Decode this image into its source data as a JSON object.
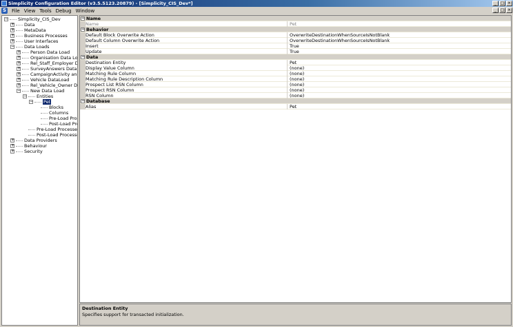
{
  "window": {
    "title": "Simplicity Configuration Editor (v3.5.5123.20879) - [Simplicity_CIS_Dev*]",
    "controls": [
      "_",
      "□",
      "×"
    ]
  },
  "menu": {
    "app_icon_letter": "S",
    "items": [
      "File",
      "View",
      "Tools",
      "Debug",
      "Window"
    ],
    "mdi_controls": [
      "_",
      "□",
      "×"
    ]
  },
  "tree": {
    "nodes": [
      {
        "label": "Simplicity_CIS_Dev",
        "depth": 0,
        "expander": "−"
      },
      {
        "label": "Data",
        "depth": 1,
        "expander": "+"
      },
      {
        "label": "MetaData",
        "depth": 1,
        "expander": "+"
      },
      {
        "label": "Business Processes",
        "depth": 1,
        "expander": "+"
      },
      {
        "label": "User Interfaces",
        "depth": 1,
        "expander": "+"
      },
      {
        "label": "Data Loads",
        "depth": 1,
        "expander": "−"
      },
      {
        "label": "Person Data Load",
        "depth": 2,
        "expander": "+"
      },
      {
        "label": "Organisation Data Load",
        "depth": 2,
        "expander": "+"
      },
      {
        "label": "Rel_Staff_Employer Data Load",
        "depth": 2,
        "expander": "+"
      },
      {
        "label": "SurveyAnswers Data Load",
        "depth": 2,
        "expander": "+"
      },
      {
        "label": "CampaignActivity and Campaign",
        "depth": 2,
        "expander": "+"
      },
      {
        "label": "Vehicle DataLoad",
        "depth": 2,
        "expander": "+"
      },
      {
        "label": "Rel_Vehicle_Owner Data Load",
        "depth": 2,
        "expander": "+"
      },
      {
        "label": "New Data Load",
        "depth": 2,
        "expander": "−"
      },
      {
        "label": "Entities",
        "depth": 3,
        "expander": "−"
      },
      {
        "label": "Pet",
        "depth": 4,
        "expander": "−",
        "selected": true
      },
      {
        "label": "Blocks",
        "depth": 5,
        "expander": ""
      },
      {
        "label": "Columns",
        "depth": 5,
        "expander": ""
      },
      {
        "label": "Pre-Load Processes",
        "depth": 5,
        "expander": ""
      },
      {
        "label": "Post-Load Processes",
        "depth": 5,
        "expander": ""
      },
      {
        "label": "Pre-Load Processes",
        "depth": 3,
        "expander": ""
      },
      {
        "label": "Post-Load Processes",
        "depth": 3,
        "expander": ""
      },
      {
        "label": "Data Providers",
        "depth": 1,
        "expander": "+"
      },
      {
        "label": "Behaviour",
        "depth": 1,
        "expander": "+"
      },
      {
        "label": "Security",
        "depth": 1,
        "expander": "+"
      }
    ]
  },
  "properties": {
    "categories": [
      {
        "name": "Name",
        "rows": [
          {
            "name": "Name",
            "value": "Pet",
            "readonly": true
          }
        ]
      },
      {
        "name": "Behavior",
        "rows": [
          {
            "name": "Default Block Overwrite Action",
            "value": "OverwriteDestinationWhenSourceIsNotBlank"
          },
          {
            "name": "Default Column Overwrite Action",
            "value": "OverwriteDestinationWhenSourceIsNotBlank"
          },
          {
            "name": "Insert",
            "value": "True"
          },
          {
            "name": "Update",
            "value": "True"
          }
        ]
      },
      {
        "name": "Data",
        "rows": [
          {
            "name": "Destination Entity",
            "value": "Pet",
            "selected": true
          },
          {
            "name": "Display Value Column",
            "value": "(none)"
          },
          {
            "name": "Matching Rule Column",
            "value": "(none)"
          },
          {
            "name": "Matching Rule Description Column",
            "value": "(none)"
          },
          {
            "name": "Prospect List RSN Column",
            "value": "(none)"
          },
          {
            "name": "Prospect RSN Column",
            "value": "(none)"
          },
          {
            "name": "RSN Column",
            "value": "(none)"
          }
        ]
      },
      {
        "name": "Database",
        "rows": [
          {
            "name": "Alias",
            "value": "Pet"
          }
        ]
      }
    ]
  },
  "description": {
    "title": "Destination Entity",
    "text": "Specifies support for transacted initialization."
  }
}
